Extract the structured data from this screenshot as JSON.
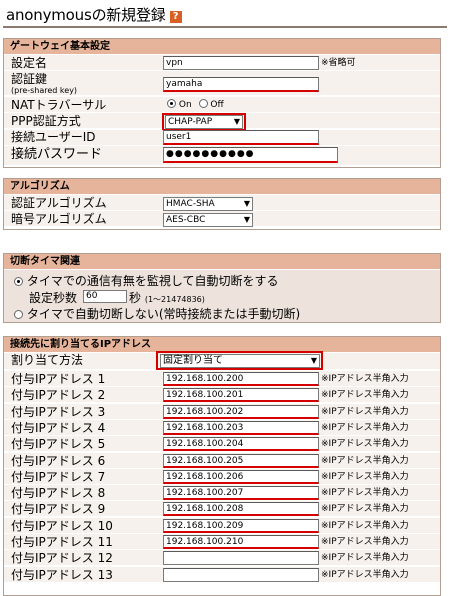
{
  "page": {
    "title": "anonymousの新規登録",
    "help_label": "?"
  },
  "gateway": {
    "section_label": "ゲートウェイ基本設定",
    "name_label": "設定名",
    "name_value": "vpn",
    "name_note": "※省略可",
    "key_label": "認証鍵",
    "key_sublabel": "(pre-shared key)",
    "key_value": "yamaha",
    "nat_label": "NATトラバーサル",
    "nat_on": "On",
    "nat_off": "Off",
    "ppp_label": "PPP認証方式",
    "ppp_value": "CHAP-PAP",
    "user_label": "接続ユーザーID",
    "user_value": "user1",
    "password_label": "接続パスワード",
    "password_value": "●●●●●●●●●●"
  },
  "algorithm": {
    "section_label": "アルゴリズム",
    "auth_label": "認証アルゴリズム",
    "auth_value": "HMAC-SHA",
    "enc_label": "暗号アルゴリズム",
    "enc_value": "AES-CBC"
  },
  "timer": {
    "section_label": "切断タイマ関連",
    "monitor_label": "タイマでの通信有無を監視して自動切断をする",
    "seconds_label": "設定秒数",
    "seconds_value": "60",
    "seconds_unit": "秒",
    "seconds_range": "(1〜21474836)",
    "no_timer_label": "タイマで自動切断しない(常時接続または手動切断)"
  },
  "ip": {
    "section_label": "接続先に割り当てるIPアドレス",
    "method_label": "割り当て方法",
    "method_value": "固定割り当て",
    "note": "※IPアドレス半角入力",
    "rows": [
      {
        "label": "付与IPアドレス 1",
        "value": "192.168.100.200"
      },
      {
        "label": "付与IPアドレス 2",
        "value": "192.168.100.201"
      },
      {
        "label": "付与IPアドレス 3",
        "value": "192.168.100.202"
      },
      {
        "label": "付与IPアドレス 4",
        "value": "192.168.100.203"
      },
      {
        "label": "付与IPアドレス 5",
        "value": "192.168.100.204"
      },
      {
        "label": "付与IPアドレス 6",
        "value": "192.168.100.205"
      },
      {
        "label": "付与IPアドレス 7",
        "value": "192.168.100.206"
      },
      {
        "label": "付与IPアドレス 8",
        "value": "192.168.100.207"
      },
      {
        "label": "付与IPアドレス 9",
        "value": "192.168.100.208"
      },
      {
        "label": "付与IPアドレス 10",
        "value": "192.168.100.209"
      },
      {
        "label": "付与IPアドレス 11",
        "value": "192.168.100.210"
      },
      {
        "label": "付与IPアドレス 12",
        "value": ""
      },
      {
        "label": "付与IPアドレス 13",
        "value": ""
      }
    ]
  },
  "colors": {
    "section_header": "#e6b49a",
    "row_bg": "#f6f1ec",
    "highlight": "#d40000"
  }
}
